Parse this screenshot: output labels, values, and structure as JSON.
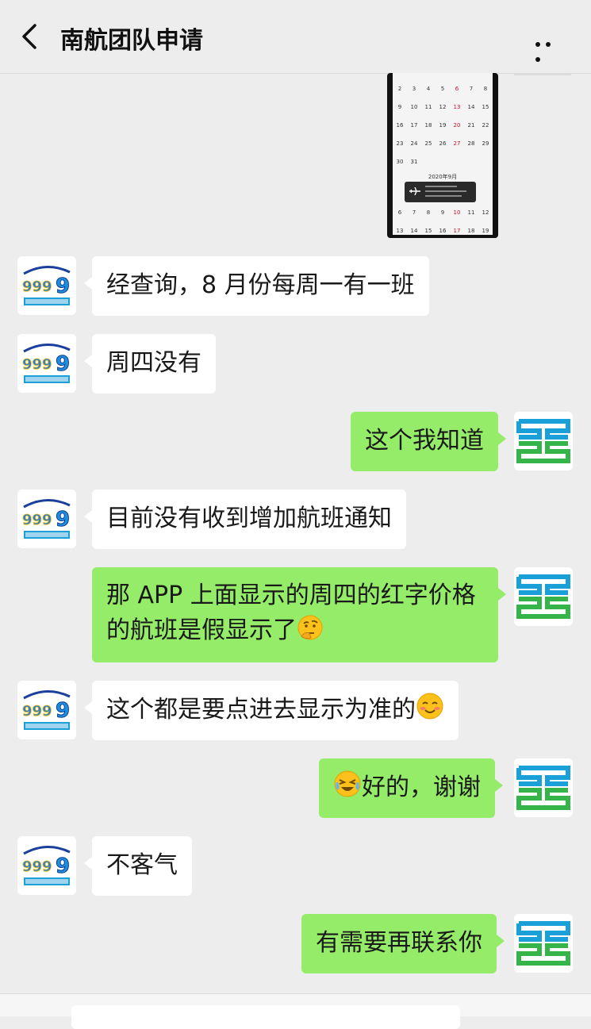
{
  "header": {
    "title": "南航团队申请"
  },
  "calendar": {
    "rows": [
      [
        "2",
        "3",
        "4",
        "5",
        "6",
        "7",
        "8"
      ],
      [
        "9",
        "10",
        "11",
        "12",
        "13",
        "14",
        "15"
      ],
      [
        "16",
        "17",
        "18",
        "19",
        "20",
        "21",
        "22"
      ],
      [
        "23",
        "24",
        "25",
        "26",
        "27",
        "28",
        "29"
      ],
      [
        "30",
        "31",
        "",
        "",
        "",
        "",
        ""
      ]
    ],
    "month_label": "2020年9月",
    "rows2": [
      [
        "6",
        "7",
        "8",
        "9",
        "10",
        "11",
        "12"
      ],
      [
        "13",
        "14",
        "15",
        "16",
        "17",
        "18",
        "19"
      ]
    ]
  },
  "messages": [
    {
      "side": "left",
      "text": "经查询，8 月份每周一有一班"
    },
    {
      "side": "left",
      "text": "周四没有"
    },
    {
      "side": "right",
      "text": "这个我知道"
    },
    {
      "side": "left",
      "text": "目前没有收到增加航班通知"
    },
    {
      "side": "right",
      "line1": "那 APP 上面显示的周四的红字价格",
      "line2": "的航班是假显示了"
    },
    {
      "side": "left",
      "text": "这个都是要点进去显示为准的"
    },
    {
      "side": "right",
      "text": "好的，谢谢"
    },
    {
      "side": "left",
      "text": "不客气"
    },
    {
      "side": "right",
      "text": "有需要再联系你"
    }
  ],
  "colors": {
    "self_bubble": "#95ec69",
    "other_bubble": "#ffffff",
    "background": "#ededed"
  }
}
